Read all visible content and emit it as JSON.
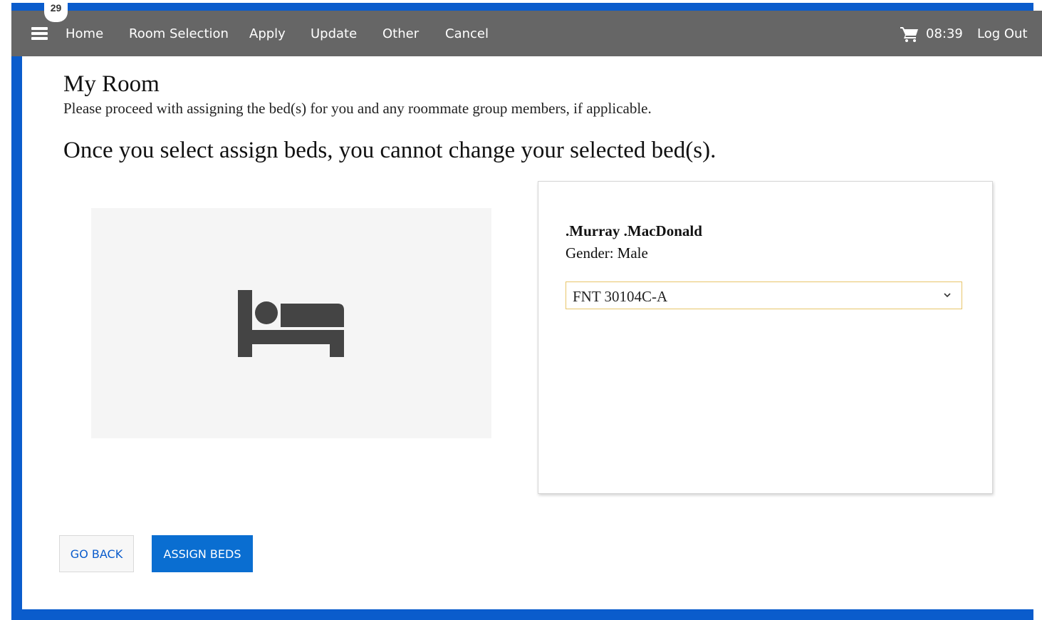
{
  "navbar": {
    "badge_count": "29",
    "links": [
      "Home",
      "Room Selection",
      "Apply",
      "Update",
      "Other",
      "Cancel"
    ],
    "time": "08:39",
    "logout_label": "Log Out"
  },
  "page": {
    "title": "My Room",
    "subtitle": "Please proceed with assigning the bed(s) for you and any roommate group members, if applicable.",
    "warning": "Once you select assign beds, you cannot change your selected bed(s)."
  },
  "resident": {
    "name": ".Murray .MacDonald",
    "gender_label": "Gender:",
    "gender_value": "Male",
    "selected_bed": "FNT 30104C-A"
  },
  "actions": {
    "go_back_label": "GO BACK",
    "assign_label": "ASSIGN BEDS"
  },
  "colors": {
    "accent_blue": "#0a5ccc",
    "navbar_gray": "#666666",
    "select_border": "#e8c56a"
  }
}
